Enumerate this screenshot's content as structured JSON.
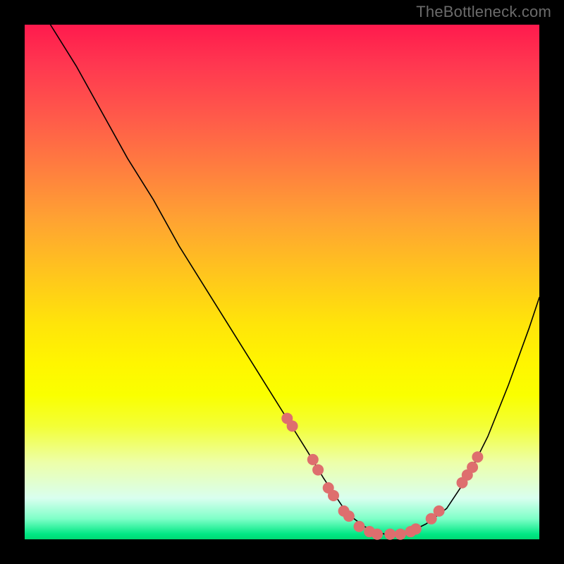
{
  "attribution": "TheBottleneck.com",
  "colors": {
    "bg": "#000000",
    "curve": "#000000",
    "marker": "#de6e6e"
  },
  "chart_data": {
    "type": "line",
    "title": "",
    "xlabel": "",
    "ylabel": "",
    "xlim": [
      0,
      100
    ],
    "ylim": [
      0,
      100
    ],
    "curve": {
      "x": [
        5,
        10,
        15,
        20,
        25,
        30,
        35,
        40,
        45,
        50,
        55,
        58,
        60,
        62,
        64,
        66,
        68,
        70,
        72,
        75,
        78,
        82,
        86,
        90,
        94,
        98,
        100
      ],
      "y": [
        100,
        92,
        83,
        74,
        66,
        57,
        49,
        41,
        33,
        25,
        17,
        12,
        9,
        6,
        4,
        2.5,
        1.5,
        1,
        1,
        1.5,
        3,
        6,
        12,
        20,
        30,
        41,
        47
      ]
    },
    "markers": [
      {
        "x": 51,
        "y": 23.5
      },
      {
        "x": 52,
        "y": 22
      },
      {
        "x": 56,
        "y": 15.5
      },
      {
        "x": 57,
        "y": 13.5
      },
      {
        "x": 59,
        "y": 10
      },
      {
        "x": 60,
        "y": 8.5
      },
      {
        "x": 62,
        "y": 5.5
      },
      {
        "x": 63,
        "y": 4.5
      },
      {
        "x": 65,
        "y": 2.5
      },
      {
        "x": 67,
        "y": 1.5
      },
      {
        "x": 68.5,
        "y": 1
      },
      {
        "x": 71,
        "y": 1
      },
      {
        "x": 73,
        "y": 1
      },
      {
        "x": 75,
        "y": 1.5
      },
      {
        "x": 76,
        "y": 2
      },
      {
        "x": 79,
        "y": 4
      },
      {
        "x": 80.5,
        "y": 5.5
      },
      {
        "x": 85,
        "y": 11
      },
      {
        "x": 86,
        "y": 12.5
      },
      {
        "x": 87,
        "y": 14
      },
      {
        "x": 88,
        "y": 16
      }
    ],
    "marker_radius_px": 8
  }
}
